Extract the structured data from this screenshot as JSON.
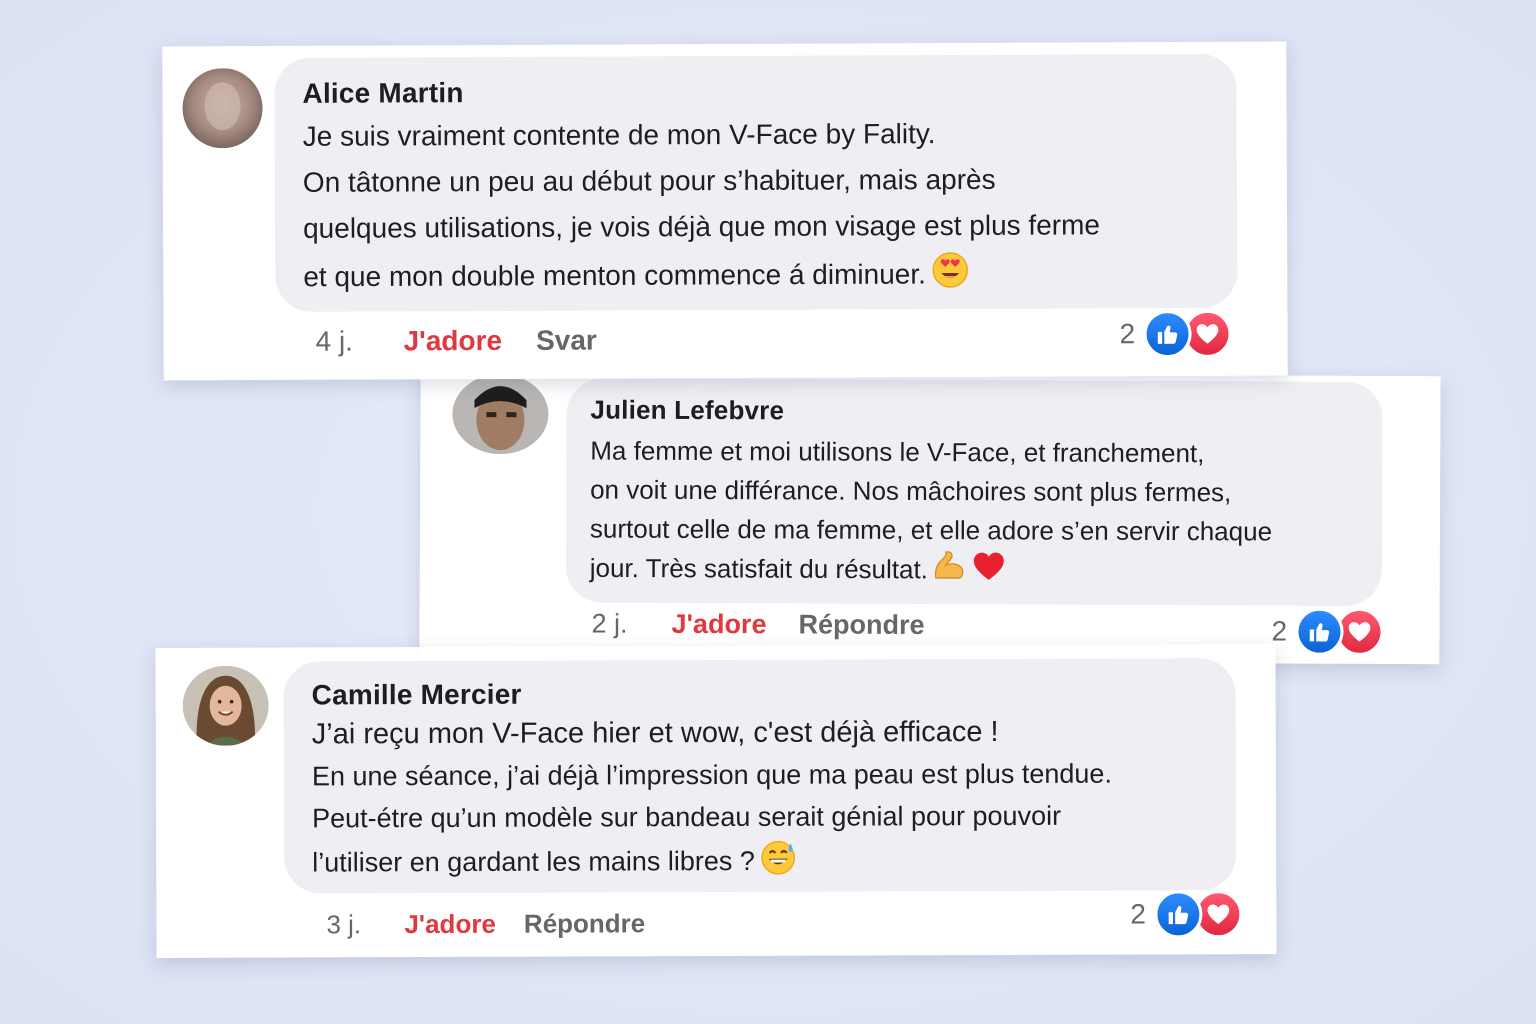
{
  "comments": [
    {
      "author": "Alice Martin",
      "lines": [
        "Je suis vraiment contente de mon V-Face by Fality.",
        "On tâtonne un peu au début pour s’habituer, mais après",
        "quelques utilisations, je vois déjà que mon visage est plus ferme",
        "et que mon double menton commence á diminuer."
      ],
      "emoji": [
        "heart-eyes-emoji"
      ],
      "time": "4 j.",
      "like_label": "J'adore",
      "reply_label": "Svar",
      "reaction_count": "2",
      "reaction_icons": [
        "like-icon",
        "love-icon"
      ]
    },
    {
      "author": "Julien Lefebvre",
      "lines": [
        "Ma femme et moi utilisons le V-Face, et franchement,",
        "on voit une différance. Nos mâchoires sont plus fermes,",
        "surtout celle de ma femme, et elle adore s’en servir chaque",
        "jour. Très satisfait du résultat."
      ],
      "emoji": [
        "flexed-biceps-emoji",
        "red-heart-emoji"
      ],
      "time": "2 j.",
      "like_label": "J'adore",
      "reply_label": "Répondre",
      "reaction_count": "2",
      "reaction_icons": [
        "like-icon",
        "love-icon"
      ]
    },
    {
      "author": "Camille Mercier",
      "lines": [
        "J’ai reçu mon V-Face hier et wow, c'est déjà efficace !",
        "En une séance, j’ai déjà l’impression que ma peau est plus tendue.",
        "Peut-étre qu’un modèle sur bandeau serait génial pour pouvoir",
        "l’utiliser en gardant les mains libres ?"
      ],
      "emoji": [
        "grinning-sweat-emoji"
      ],
      "time": "3 j.",
      "like_label": "J'adore",
      "reply_label": "Répondre",
      "reaction_count": "2",
      "reaction_icons": [
        "like-icon",
        "love-icon"
      ]
    }
  ],
  "colors": {
    "background": "#dfe5f6",
    "bubble": "#efeff3",
    "like_text": "#e0383e",
    "meta_text": "#65676b",
    "like_blue": "#1877f2",
    "love_red": "#f33e58"
  }
}
